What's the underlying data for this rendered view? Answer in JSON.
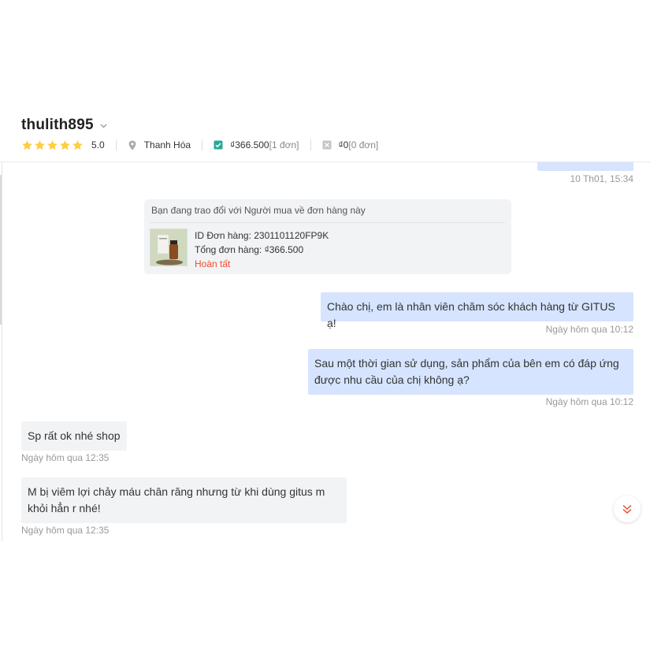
{
  "header": {
    "username": "thulith895",
    "rating": "5.0",
    "location": "Thanh Hóa",
    "completed_amount": "₫366.500",
    "completed_count": "[1 đơn]",
    "cancelled_amount": "₫0",
    "cancelled_count": "[0 đơn]",
    "star_count": 5,
    "colors": {
      "star": "#ffce3d",
      "check": "#26aa99",
      "accent": "#ee4d2d"
    }
  },
  "messages": {
    "first_timestamp": "10 Th01, 15:34",
    "order_card": {
      "title": "Bạn đang trao đổi với Người mua về đơn hàng này",
      "order_id": "ID Đơn hàng: 2301101120FP9K",
      "total": "Tổng đơn hàng: ₫366.500",
      "status": "Hoàn tất"
    },
    "list": [
      {
        "text": "Chào chị, em là nhân viên chăm sóc khách hàng từ GITUS ạ!",
        "time": "Ngày hôm qua 10:12"
      },
      {
        "text": "Sau một thời gian sử dụng, sản phẩm của bên em có đáp ứng được nhu cầu của chị không ạ?",
        "time": "Ngày hôm qua 10:12"
      },
      {
        "text": "Sp rất ok nhé shop",
        "time": "Ngày hôm qua 12:35"
      },
      {
        "text": "M bị viêm lợi chảy máu chân răng nhưng từ khi dùng gitus m khỏi hẳn r nhé!",
        "time": "Ngày hôm qua 12:35"
      }
    ]
  },
  "icons": {
    "dropdown": "chevron-down-icon",
    "star": "star-icon",
    "location": "location-pin-icon",
    "completed": "check-square-icon",
    "cancelled": "cancel-square-icon",
    "product": "product-thumbnail",
    "scroll": "double-chevron-down-icon"
  }
}
